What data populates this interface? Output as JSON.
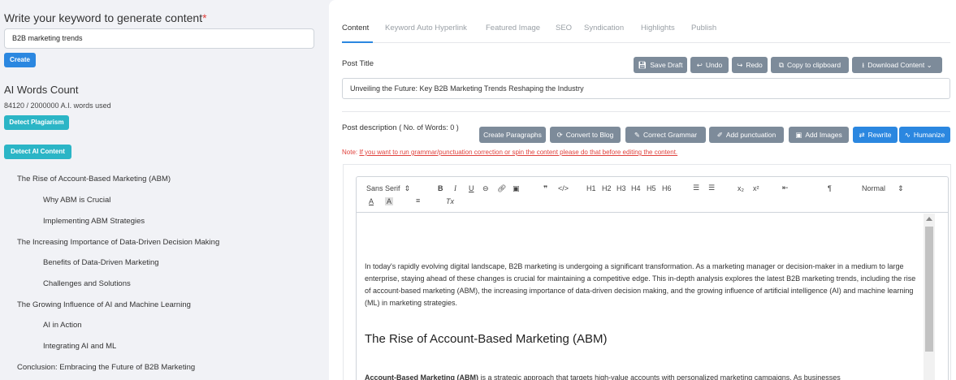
{
  "keyword": {
    "title": "Write your keyword to generate content",
    "required_mark": "*",
    "value": "B2B marketing trends",
    "create_label": "Create"
  },
  "ai_words": {
    "title": "AI Words Count",
    "used": "84120 / 2000000 A.I. words used",
    "plagiarism_label": "Detect Plagiarism",
    "ai_content_label": "Detect AI Content"
  },
  "outline": [
    {
      "level": 2,
      "text": "The Rise of Account-Based Marketing (ABM)"
    },
    {
      "level": 3,
      "text": "Why ABM is Crucial"
    },
    {
      "level": 3,
      "text": "Implementing ABM Strategies"
    },
    {
      "level": 2,
      "text": "The Increasing Importance of Data-Driven Decision Making"
    },
    {
      "level": 3,
      "text": "Benefits of Data-Driven Marketing"
    },
    {
      "level": 3,
      "text": "Challenges and Solutions"
    },
    {
      "level": 2,
      "text": "The Growing Influence of AI and Machine Learning"
    },
    {
      "level": 3,
      "text": "AI in Action"
    },
    {
      "level": 3,
      "text": "Integrating AI and ML"
    },
    {
      "level": 2,
      "text": "Conclusion: Embracing the Future of B2B Marketing"
    }
  ],
  "tabs": [
    "Content",
    "Keyword Auto Hyperlink",
    "Featured Image",
    "SEO",
    "Syndication",
    "Highlights",
    "Publish"
  ],
  "post_title": {
    "label": "Post Title",
    "value": "Unveiling the Future: Key B2B Marketing Trends Reshaping the Industry"
  },
  "title_actions": {
    "save_draft": "Save Draft",
    "undo": "Undo",
    "redo": "Redo",
    "copy": "Copy to clipboard",
    "download": "Download Content"
  },
  "description": {
    "label": "Post description",
    "words_prefix": "( No. of Words:",
    "words_count": "0 )"
  },
  "desc_actions": {
    "create_paragraphs": "Create Paragraphs",
    "convert_blog": "Convert to Blog",
    "correct_grammar": "Correct Grammar",
    "add_punctuation": "Add punctuation",
    "add_images": "Add Images",
    "rewrite": "Rewrite",
    "humanize": "Humanize"
  },
  "note": {
    "prefix": "Note:",
    "text": "If you want to run grammar/punctuation correction or spin the content please do that before editing the content."
  },
  "editor_toolbar": {
    "font": "Sans Serif",
    "size": "Normal",
    "bold": "B",
    "italic": "I",
    "underline": "U",
    "quote": "❞",
    "code": "</>",
    "h1": "H1",
    "h2": "H2",
    "h3": "H3",
    "h4": "H4",
    "h5": "H5",
    "h6": "H6",
    "sub": "x₂",
    "sup": "x²",
    "clear": "Tx",
    "text_color": "A",
    "bg_color": "A"
  },
  "editor_content": {
    "intro": "In today's rapidly evolving digital landscape, B2B marketing is undergoing a significant transformation. As a marketing manager or decision-maker in a medium to large enterprise, staying ahead of these changes is crucial for maintaining a competitive edge. This in-depth analysis explores the latest B2B marketing trends, including the rise of account-based marketing (ABM), the increasing importance of data-driven decision making, and the growing influence of artificial intelligence (AI) and machine learning (ML) in marketing strategies.",
    "heading": "The Rise of Account-Based Marketing (ABM)",
    "para2_bold": "Account-Based Marketing (ABM)",
    "para2": " is a strategic approach that targets high-value accounts with personalized marketing campaigns. As businesses"
  },
  "colors": {
    "accent": "#2b87e0",
    "teal": "#2bb5c6",
    "gray_btn": "#7d8b9a",
    "note_red": "#e0413c"
  }
}
